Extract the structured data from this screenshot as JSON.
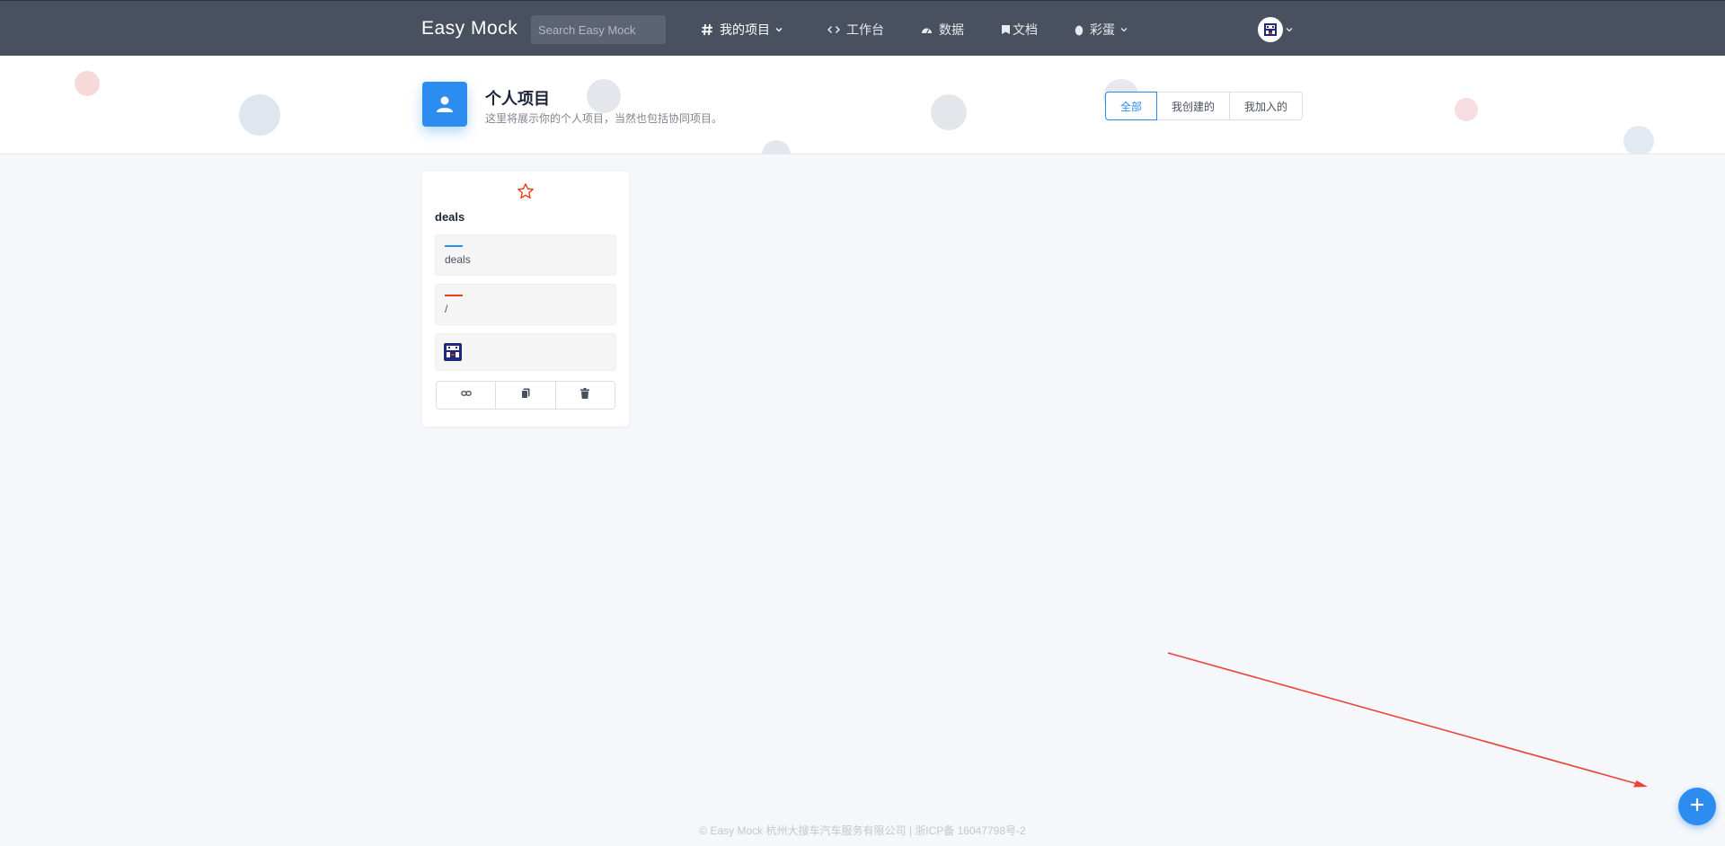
{
  "nav": {
    "brand": "Easy Mock",
    "search_placeholder": "Search Easy Mock",
    "items": [
      {
        "label": "我的项目",
        "icon": "hash-icon",
        "dropdown": true
      },
      {
        "label": "工作台",
        "icon": "code-icon",
        "dropdown": false
      },
      {
        "label": "数据",
        "icon": "chart-icon",
        "dropdown": false
      },
      {
        "label": "文档",
        "icon": "book-icon",
        "dropdown": false
      },
      {
        "label": "彩蛋",
        "icon": "egg-icon",
        "dropdown": true
      }
    ]
  },
  "header": {
    "title": "个人项目",
    "subtitle": "这里将展示你的个人项目，当然也包括协同项目。",
    "filters": [
      "全部",
      "我创建的",
      "我加入的"
    ],
    "active_filter": "全部"
  },
  "project": {
    "name": "deals",
    "url": "deals",
    "description": "/",
    "actions": [
      "link-icon",
      "copy-icon",
      "delete-icon"
    ]
  },
  "footer": {
    "text": "© Easy Mock 杭州大搜车汽车服务有限公司 | 浙ICP备 16047798号-2"
  },
  "colors": {
    "topbar": "#495060",
    "accent": "#2d8cf0",
    "star": "#ed3f14",
    "annotation_arrow": "#e8443a"
  }
}
